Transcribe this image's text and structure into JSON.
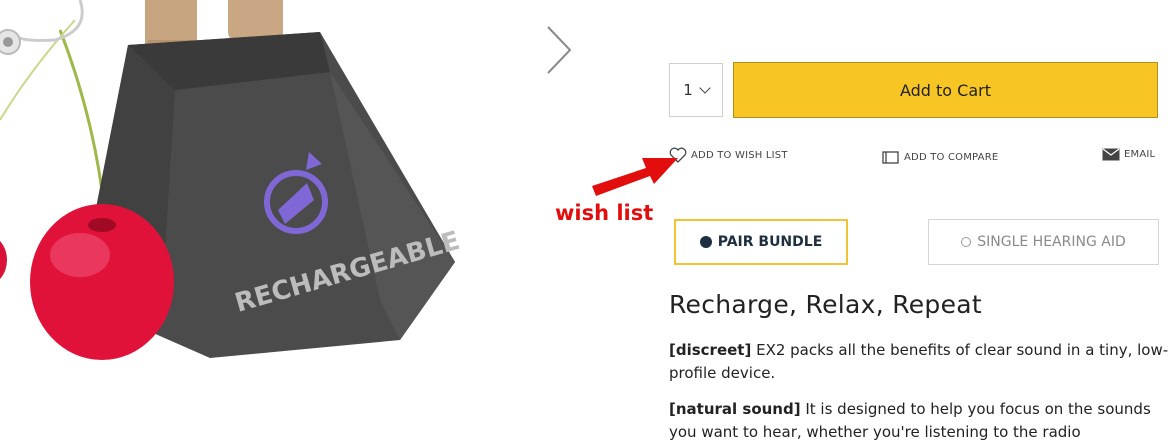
{
  "product_image": {
    "stand_label": "RECHARGEABLE",
    "icon": "recharge-cycle-icon"
  },
  "gallery": {
    "next_icon": "chevron-right-icon"
  },
  "purchase": {
    "quantity": "1",
    "add_to_cart": "Add to Cart",
    "accent_color": "#f7c624"
  },
  "actions": {
    "wish_list": "ADD TO WISH LIST",
    "compare": "ADD TO COMPARE",
    "email": "EMAIL"
  },
  "annotation": {
    "label": "wish list",
    "color": "#e20d0d"
  },
  "options": {
    "pair_bundle": "PAIR BUNDLE",
    "single_aid": "SINGLE HEARING AID"
  },
  "description": {
    "heading": "Recharge, Relax, Repeat",
    "p1_tag": "[discreet]",
    "p1_text": " EX2 packs all the benefits of clear sound in a tiny, low-profile device.",
    "p2_tag": "[natural sound]",
    "p2_text": " It is designed to help you focus on the sounds you want to hear, whether you're listening to the radio"
  }
}
